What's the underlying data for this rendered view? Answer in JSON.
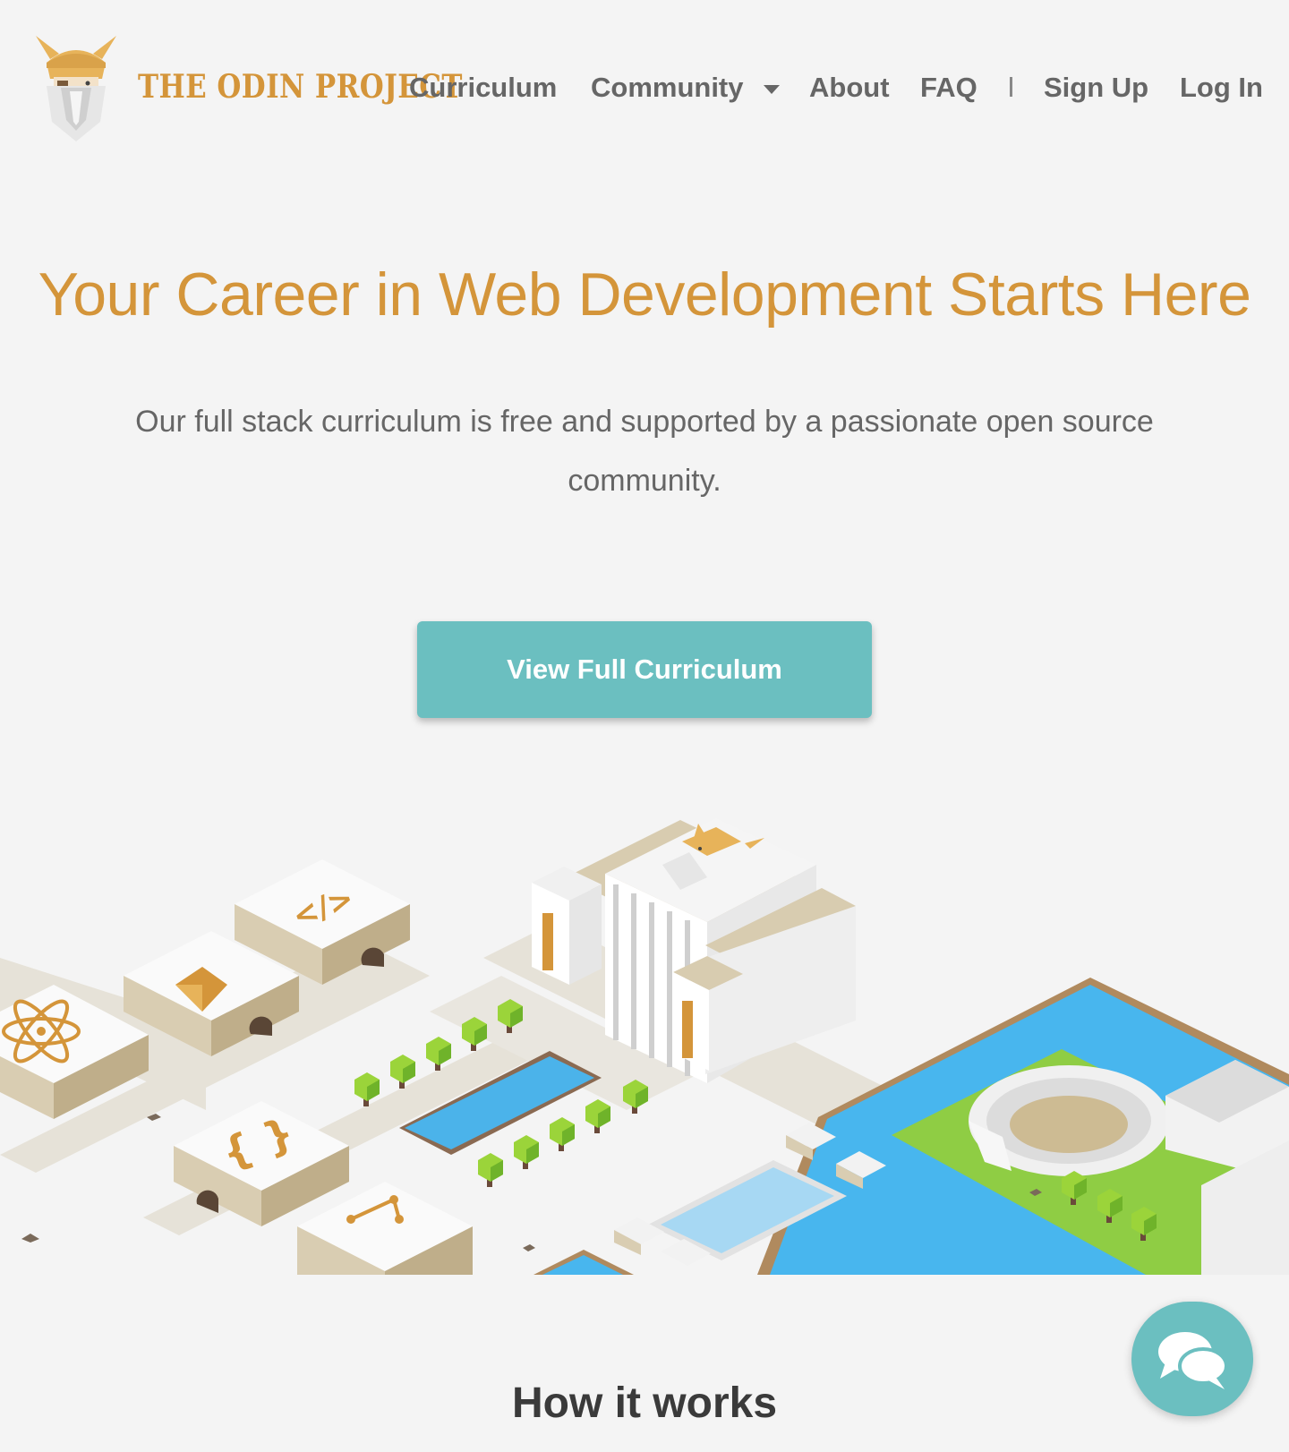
{
  "brand": {
    "name": "THE ODIN PROJECT",
    "accent": "#d4953a",
    "teal": "#6bbfc0",
    "background": "#f4f4f4"
  },
  "nav": {
    "curriculum": "Curriculum",
    "community": "Community",
    "about": "About",
    "faq": "FAQ",
    "separator": "|",
    "sign_up": "Sign Up",
    "log_in": "Log In"
  },
  "hero": {
    "title": "Your Career in Web Development Starts Here",
    "subtitle": "Our full stack curriculum is free and supported by a passionate open source community.",
    "cta_label": "View Full Curriculum"
  },
  "how": {
    "title": "How it works"
  },
  "icons": {
    "logo": "viking-odin-logo",
    "dropdown": "chevron-down-icon",
    "chat": "chat-bubbles-icon",
    "illustration": "isometric-city-illustration"
  }
}
